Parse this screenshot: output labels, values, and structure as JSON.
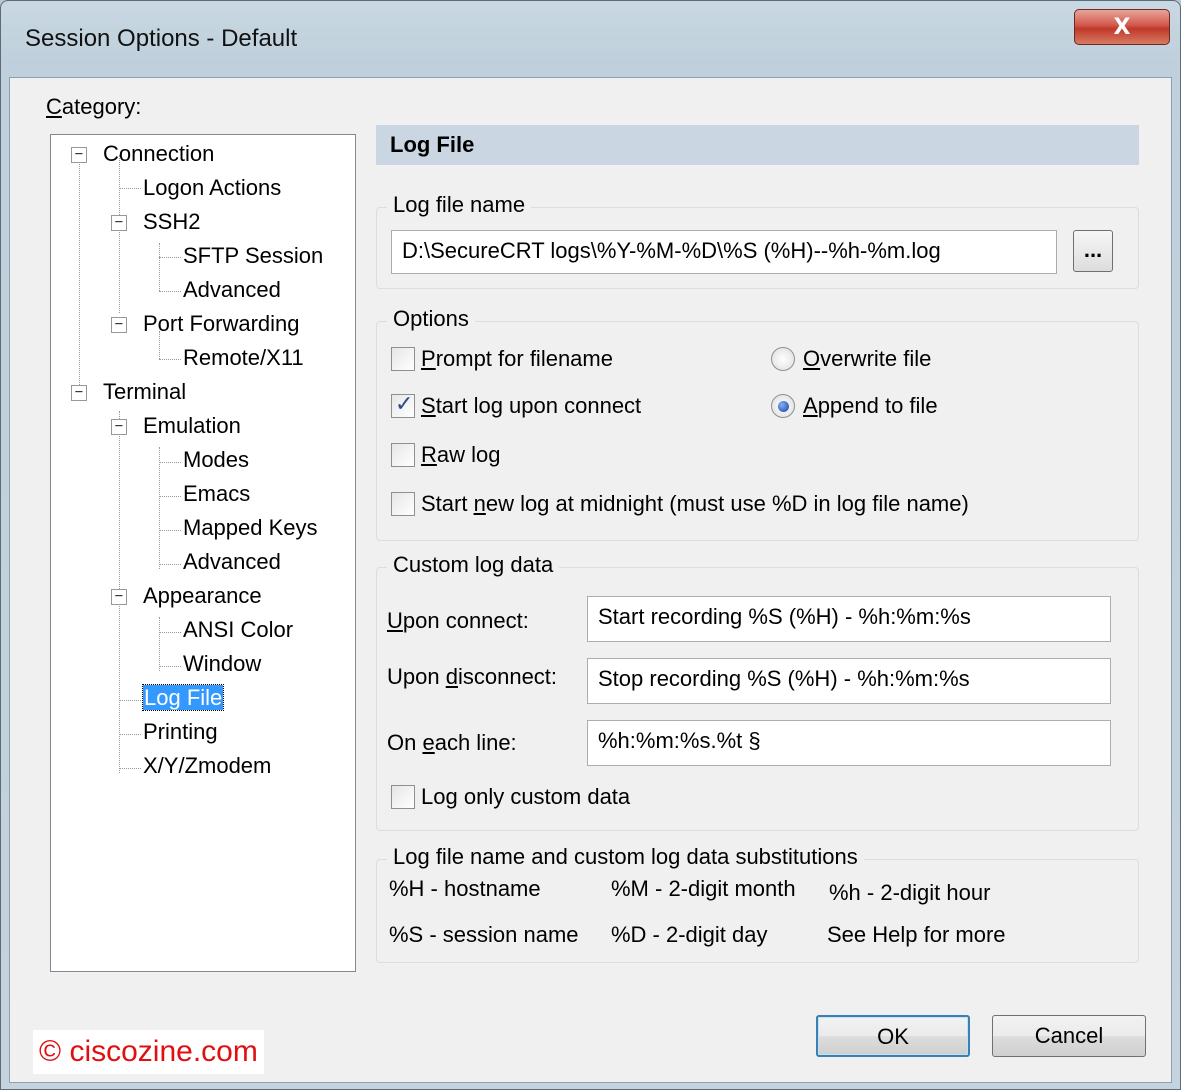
{
  "window": {
    "title": "Session Options - Default",
    "close_label": "X"
  },
  "category_label": {
    "u": "C",
    "rest": "ategory:"
  },
  "tree": [
    {
      "label": "Connection"
    },
    {
      "label": "Logon Actions"
    },
    {
      "label": "SSH2"
    },
    {
      "label": "SFTP Session"
    },
    {
      "label": "Advanced"
    },
    {
      "label": "Port Forwarding"
    },
    {
      "label": "Remote/X11"
    },
    {
      "label": "Terminal"
    },
    {
      "label": "Emulation"
    },
    {
      "label": "Modes"
    },
    {
      "label": "Emacs"
    },
    {
      "label": "Mapped Keys"
    },
    {
      "label": "Advanced"
    },
    {
      "label": "Appearance"
    },
    {
      "label": "ANSI Color"
    },
    {
      "label": "Window"
    },
    {
      "label": "Log File"
    },
    {
      "label": "Printing"
    },
    {
      "label": "X/Y/Zmodem"
    }
  ],
  "panel": {
    "header": "Log File",
    "log_file_name": {
      "title": "Log file name",
      "value": "D:\\SecureCRT logs\\%Y-%M-%D\\%S (%H)--%h-%m.log",
      "browse_label": "..."
    },
    "options": {
      "title": "Options",
      "prompt": {
        "u": "P",
        "rest": "rompt for filename",
        "checked": false
      },
      "start_log": {
        "u": "S",
        "rest": "tart log upon connect",
        "checked": true
      },
      "raw_log": {
        "u": "R",
        "rest": "aw log",
        "checked": false
      },
      "midnight": {
        "pre": "Start ",
        "u": "n",
        "rest": "ew log at midnight (must use %D in log file name)",
        "checked": false
      },
      "overwrite": {
        "u": "O",
        "rest": "verwrite file",
        "selected": false
      },
      "append": {
        "u": "A",
        "rest": "ppend to file",
        "selected": true
      }
    },
    "custom": {
      "title": "Custom log data",
      "upon_connect": {
        "u": "U",
        "rest": "pon connect:",
        "value": "Start recording %S (%H) - %h:%m:%s"
      },
      "upon_disconnect": {
        "pre": "Upon ",
        "u": "d",
        "rest": "isconnect:",
        "value": "Stop recording %S (%H) - %h:%m:%s"
      },
      "each_line": {
        "pre": "On ",
        "u": "e",
        "rest": "ach line:",
        "value": "%h:%m:%s.%t §"
      },
      "log_only": {
        "pre": "Lo",
        "u": "g",
        "rest": " only custom data",
        "checked": false
      }
    },
    "substitutions": {
      "title": "Log file name and custom log data substitutions",
      "items": [
        "%H - hostname",
        "%M - 2-digit month",
        "%h - 2-digit hour",
        "%S - session name",
        "%D - 2-digit day",
        "See Help for more"
      ]
    }
  },
  "buttons": {
    "ok": "OK",
    "cancel": "Cancel"
  },
  "watermark": "© ciscozine.com"
}
